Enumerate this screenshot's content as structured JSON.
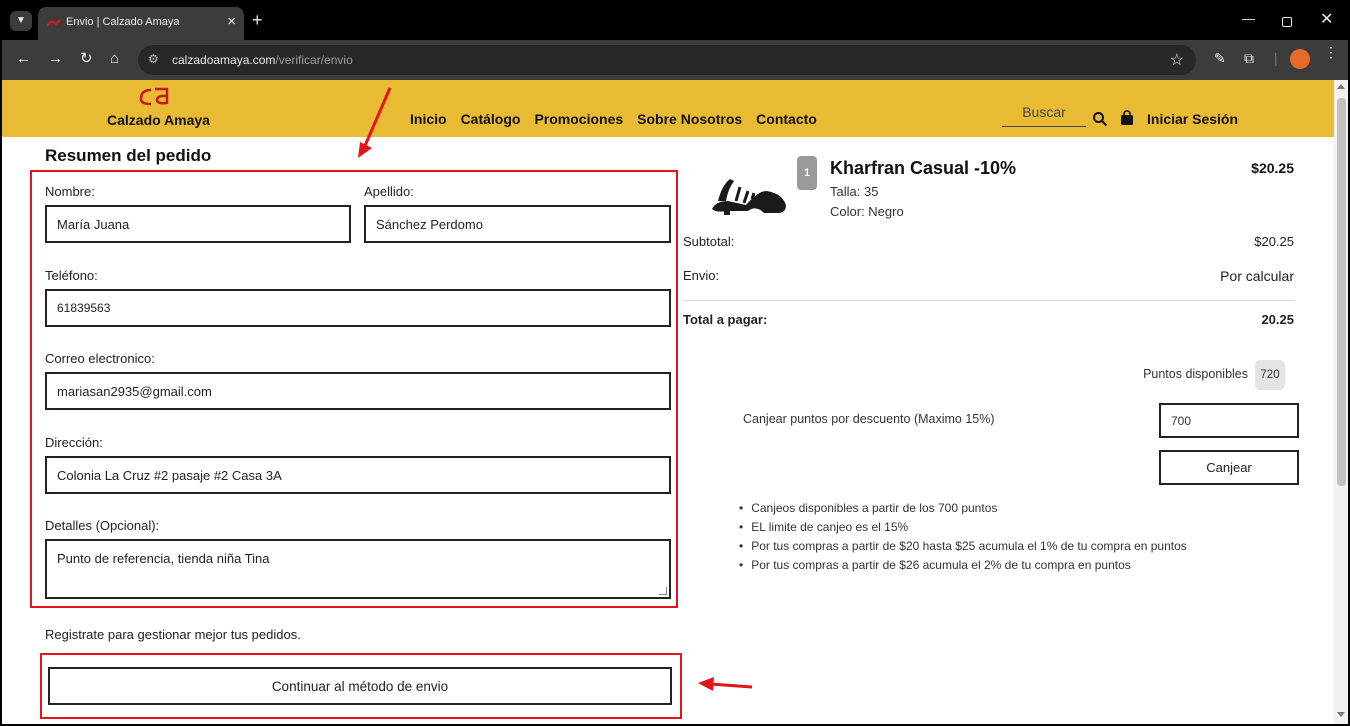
{
  "browser": {
    "tab_title": "Envio | Calzado Amaya",
    "url_domain": "calzadoamaya.com",
    "url_path": "/verificar/envio"
  },
  "header": {
    "brand": "Calzado Amaya",
    "nav": [
      "Inicio",
      "Catálogo",
      "Promociones",
      "Sobre Nosotros",
      "Contacto"
    ],
    "search_label": "Buscar",
    "login_label": "Iniciar Sesión",
    "accent_color": "#e9bb35"
  },
  "form": {
    "title": "Resumen del pedido",
    "first_name": {
      "label": "Nombre:",
      "value": "María Juana"
    },
    "last_name": {
      "label": "Apellido:",
      "value": "Sánchez Perdomo"
    },
    "phone": {
      "label": "Teléfono:",
      "value": "61839563"
    },
    "email": {
      "label": "Correo electronico:",
      "value": "mariasan2935@gmail.com"
    },
    "address": {
      "label": "Dirección:",
      "value": "Colonia La Cruz #2 pasaje #2 Casa 3A"
    },
    "details": {
      "label": "Detalles (Opcional):",
      "value": "Punto de referencia, tienda niña Tina"
    },
    "register_text": "Registrate para gestionar mejor tus pedidos.",
    "continue_label": "Continuar al método de envio"
  },
  "summary": {
    "product": {
      "quantity": "1",
      "name": "Kharfran Casual -10%",
      "size": "Talla: 35",
      "color": "Color: Negro",
      "price": "$20.25"
    },
    "subtotal": {
      "label": "Subtotal:",
      "value": "$20.25"
    },
    "shipping": {
      "label": "Envio:",
      "value": "Por calcular"
    },
    "total": {
      "label": "Total a pagar:",
      "value": "20.25"
    },
    "points": {
      "label": "Puntos disponibles",
      "value": "720"
    },
    "redeem": {
      "label": "Canjear puntos por descuento (Maximo 15%)",
      "input_value": "700",
      "button_label": "Canjear"
    },
    "rules": [
      "Canjeos disponibles a partir de los 700 puntos",
      "EL limite de canjeo es el 15%",
      "Por tus compras a partir de $20 hasta $25 acumula el 1% de tu compra en puntos",
      "Por tus compras a partir de $26 acumula el 2% de tu compra en puntos"
    ]
  },
  "annotation_color": "#e3141b"
}
